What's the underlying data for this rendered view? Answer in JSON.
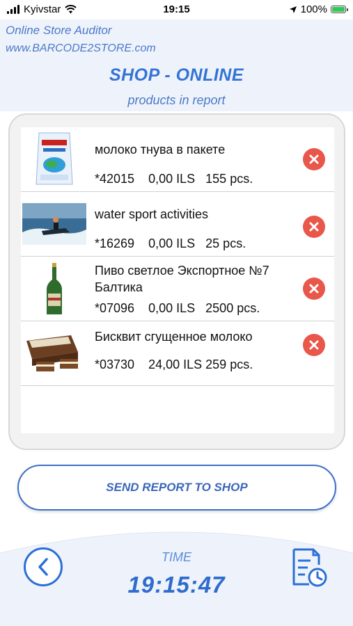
{
  "status_bar": {
    "carrier": "Kyivstar",
    "time": "19:15",
    "battery": "100%"
  },
  "header": {
    "app_title": "Online Store Auditor",
    "app_url": "www.BARCODE2STORE.com",
    "shop_title": "SHOP - ONLINE",
    "subtitle": "products in report"
  },
  "products": [
    {
      "name": "молоко тнува в пакете",
      "code": "*42015",
      "price": "0,00 ILS",
      "qty": "155 pcs.",
      "image": "milk-bag"
    },
    {
      "name": "water sport activities",
      "code": "*16269",
      "price": "0,00 ILS",
      "qty": "25 pcs.",
      "image": "jet-ski"
    },
    {
      "name": "Пиво светлое Экспортное №7 Балтика",
      "code": "*07096",
      "price": "0,00 ILS",
      "qty": "2500 pcs.",
      "image": "beer-bottle"
    },
    {
      "name": "Бисквит сгущенное молоко",
      "code": "*03730",
      "price": "24,00 ILS",
      "qty": "259 pcs.",
      "image": "biscuit-cake"
    }
  ],
  "actions": {
    "send_report": "SEND REPORT TO SHOP"
  },
  "footer": {
    "time_label": "TIME",
    "time_value": "19:15:47"
  },
  "icons": {
    "delete": "delete-icon",
    "back": "chevron-left-icon",
    "history": "report-history-icon"
  },
  "colors": {
    "accent": "#3573d4",
    "delete": "#e8574a",
    "header_bg": "#eef3fb"
  }
}
